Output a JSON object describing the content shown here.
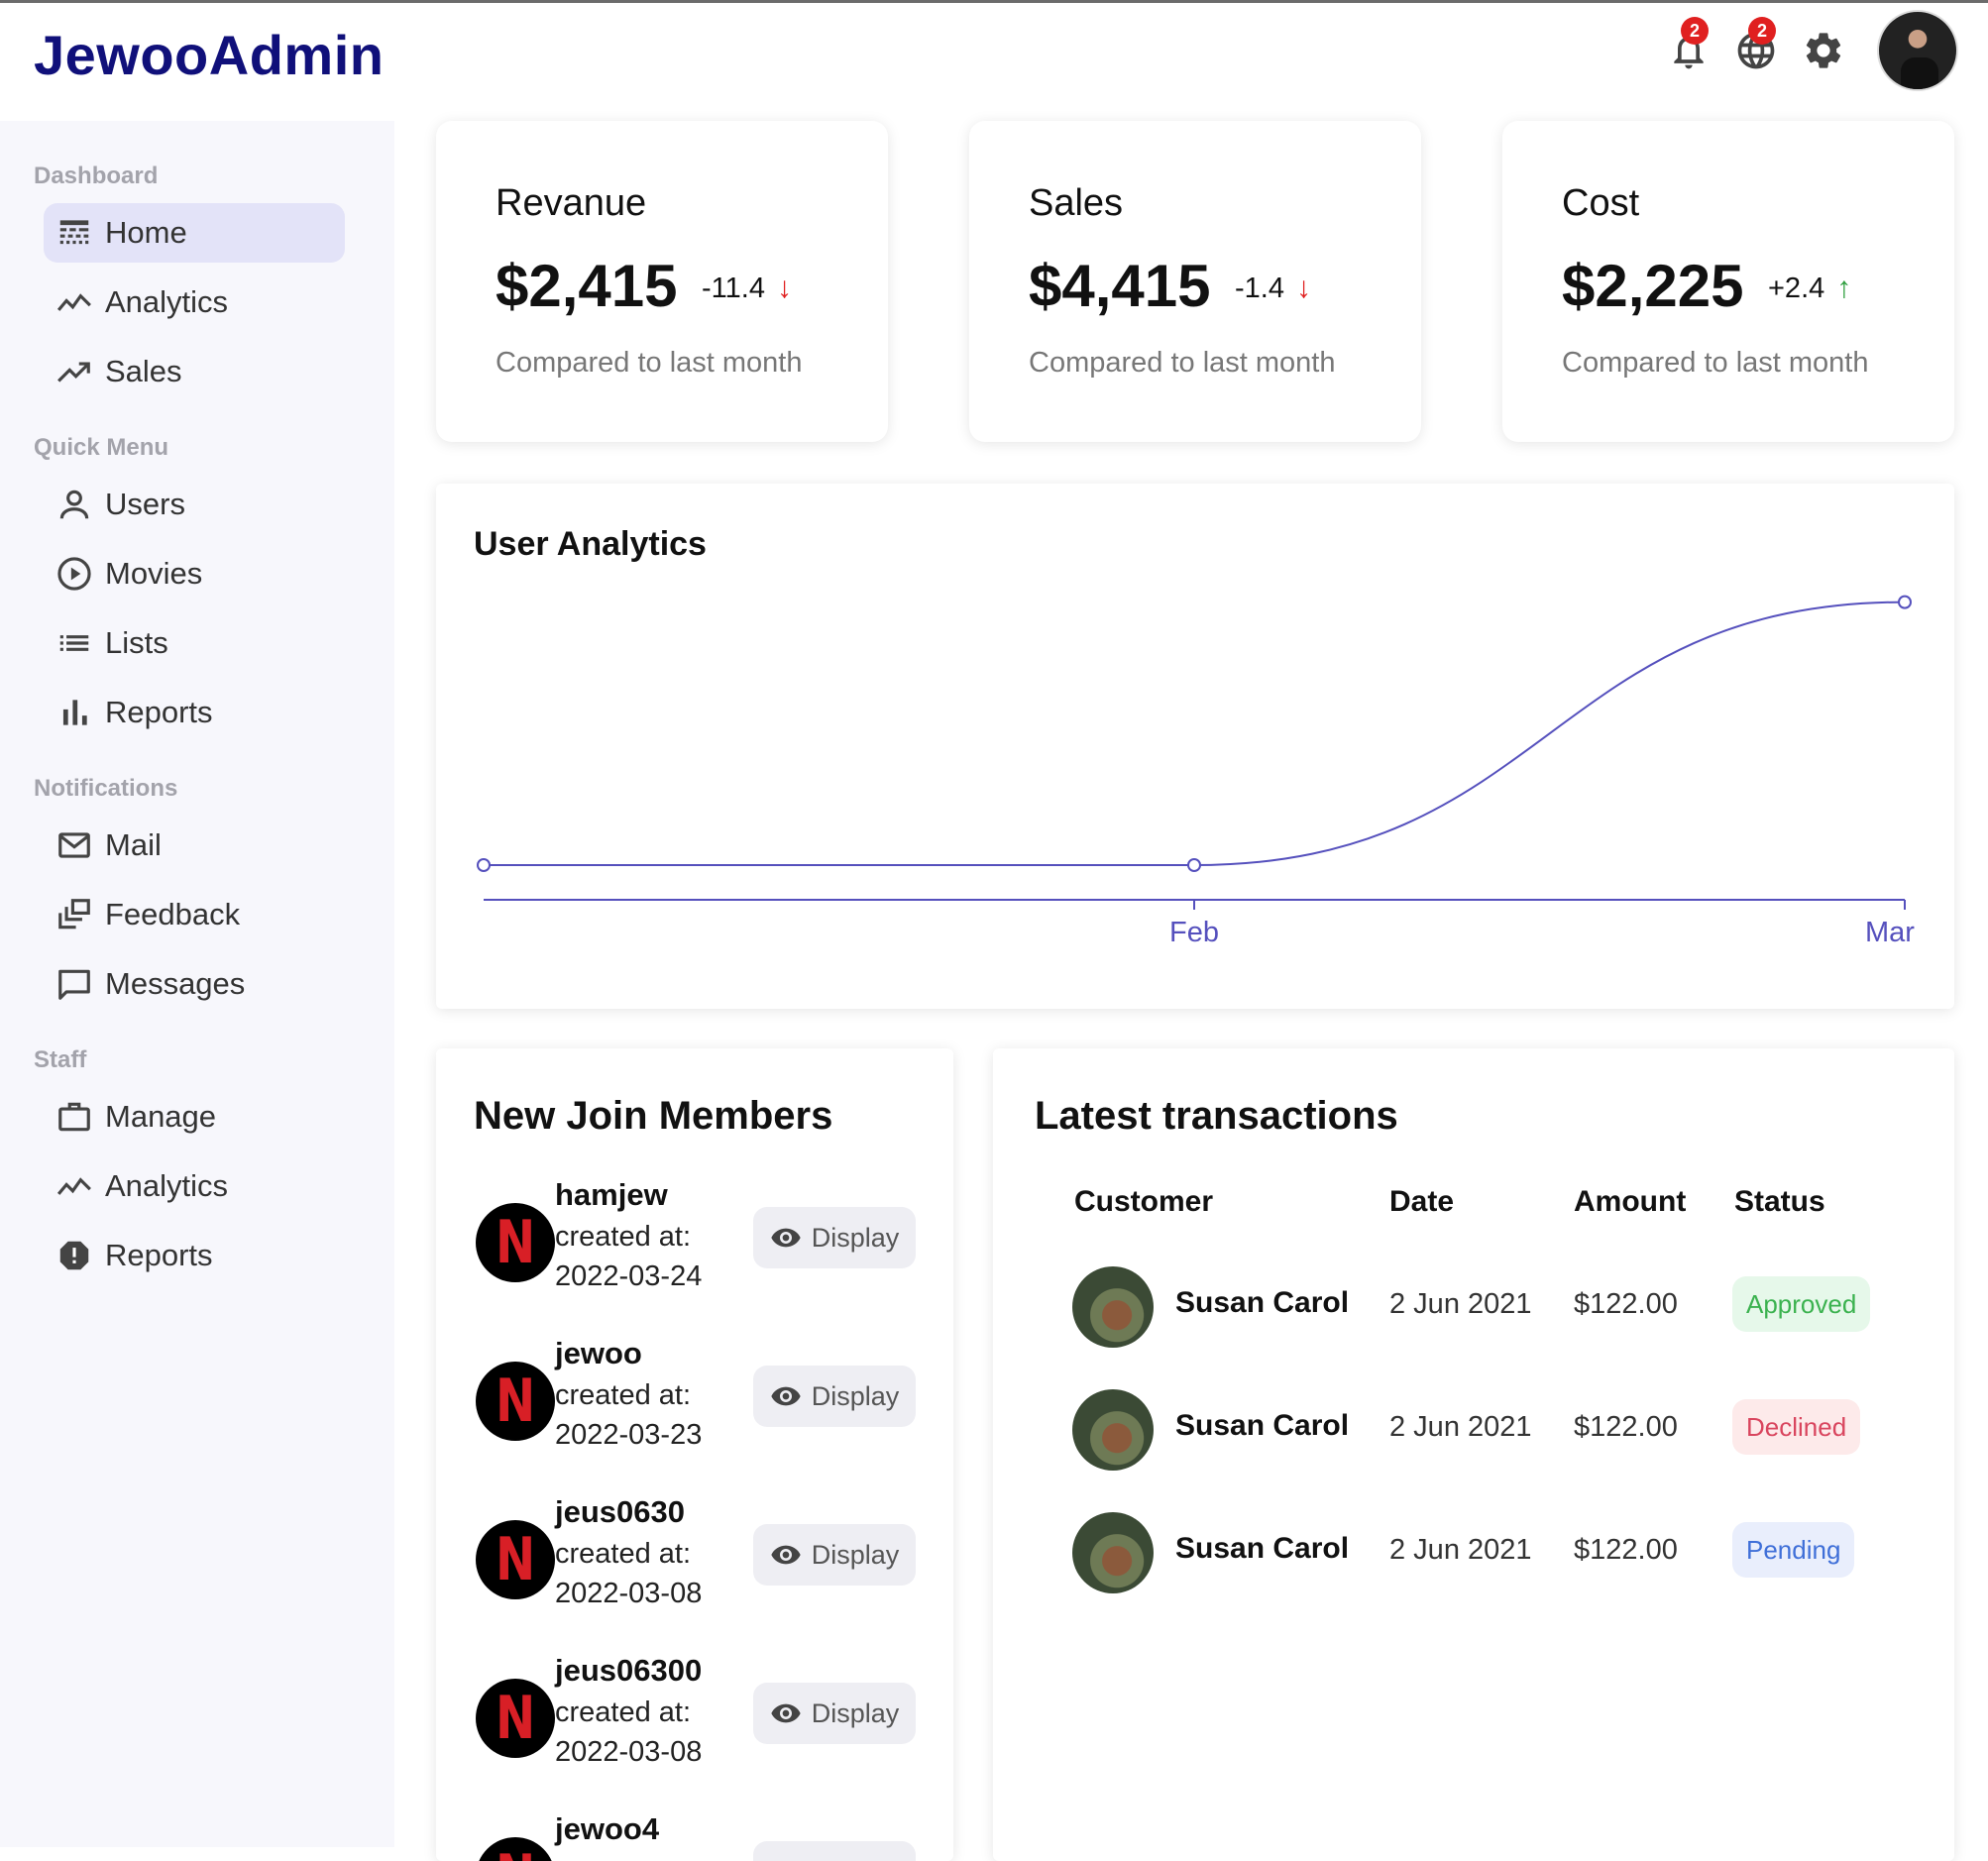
{
  "app": {
    "logo": "JewooAdmin"
  },
  "topbar": {
    "notifications_badge": "2",
    "language_badge": "2"
  },
  "sidebar": {
    "sections": [
      {
        "title": "Dashboard",
        "items": [
          {
            "label": "Home",
            "icon": "home-icon"
          },
          {
            "label": "Analytics",
            "icon": "timeline-icon"
          },
          {
            "label": "Sales",
            "icon": "trending-up-icon"
          }
        ]
      },
      {
        "title": "Quick Menu",
        "items": [
          {
            "label": "Users",
            "icon": "user-icon"
          },
          {
            "label": "Movies",
            "icon": "play-circle-icon"
          },
          {
            "label": "Lists",
            "icon": "list-icon"
          },
          {
            "label": "Reports",
            "icon": "bar-chart-icon"
          }
        ]
      },
      {
        "title": "Notifications",
        "items": [
          {
            "label": "Mail",
            "icon": "mail-icon"
          },
          {
            "label": "Feedback",
            "icon": "dynamic-feed-icon"
          },
          {
            "label": "Messages",
            "icon": "chat-bubble-icon"
          }
        ]
      },
      {
        "title": "Staff",
        "items": [
          {
            "label": "Manage",
            "icon": "work-icon"
          },
          {
            "label": "Analytics",
            "icon": "timeline-icon"
          },
          {
            "label": "Reports",
            "icon": "report-icon"
          }
        ]
      }
    ]
  },
  "kpis": [
    {
      "title": "Revanue",
      "value": "$2,415",
      "delta": "-11.4",
      "arrow": "↓",
      "subtitle": "Compared to last month"
    },
    {
      "title": "Sales",
      "value": "$4,415",
      "delta": "-1.4",
      "arrow": "↓",
      "subtitle": "Compared to last month"
    },
    {
      "title": "Cost",
      "value": "$2,225",
      "delta": "+2.4",
      "arrow": "↑",
      "subtitle": "Compared to last month"
    }
  ],
  "colors": {
    "down": "#e02020",
    "up": "#2e9e3e",
    "chart_line": "#5550bd",
    "accent": "#10107a"
  },
  "user_analytics": {
    "title": "User Analytics"
  },
  "chart_data": {
    "type": "line",
    "title": "User Analytics",
    "categories": [
      "",
      "Feb",
      "Mar"
    ],
    "series": [
      {
        "values": [
          0,
          0,
          1
        ]
      }
    ],
    "ylim": [
      0,
      1.3
    ],
    "grid": false,
    "legend": "none"
  },
  "members": {
    "title": "New Join Members",
    "created_label": "created at:",
    "button_label": "Display",
    "items": [
      {
        "username": "hamjew",
        "date": "2022-03-24"
      },
      {
        "username": "jewoo",
        "date": "2022-03-23"
      },
      {
        "username": "jeus0630",
        "date": "2022-03-08"
      },
      {
        "username": "jeus06300",
        "date": "2022-03-08"
      },
      {
        "username": "jewoo4",
        "date": ""
      }
    ]
  },
  "transactions": {
    "title": "Latest transactions",
    "headers": [
      "Customer",
      "Date",
      "Amount",
      "Status"
    ],
    "rows": [
      {
        "customer": "Susan Carol",
        "date": "2 Jun 2021",
        "amount": "$122.00",
        "status": "Approved"
      },
      {
        "customer": "Susan Carol",
        "date": "2 Jun 2021",
        "amount": "$122.00",
        "status": "Declined"
      },
      {
        "customer": "Susan Carol",
        "date": "2 Jun 2021",
        "amount": "$122.00",
        "status": "Pending"
      }
    ]
  }
}
